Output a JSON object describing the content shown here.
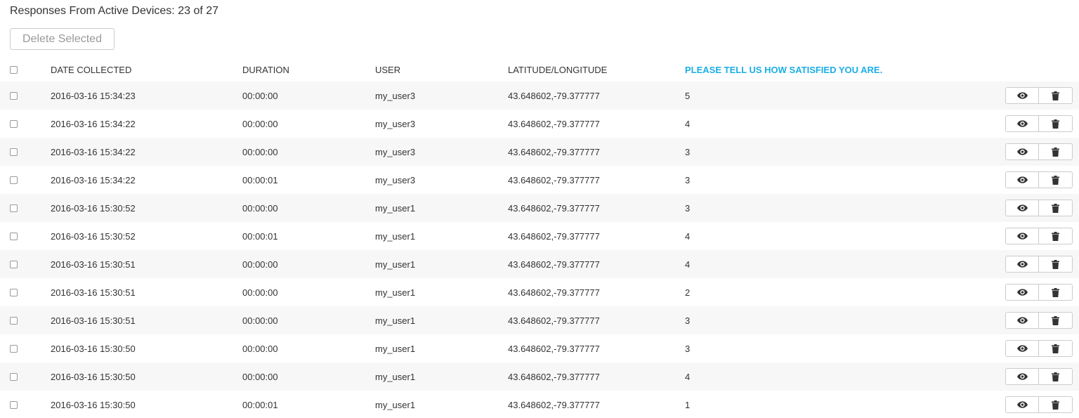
{
  "summary": "Responses From Active Devices: 23 of 27",
  "toolbar": {
    "delete_selected_label": "Delete Selected"
  },
  "table": {
    "headers": {
      "date": "DATE COLLECTED",
      "duration": "DURATION",
      "user": "USER",
      "latlong": "LATITUDE/LONGITUDE",
      "question": "PLEASE TELL US HOW SATISFIED YOU ARE."
    },
    "rows": [
      {
        "date": "2016-03-16 15:34:23",
        "duration": "00:00:00",
        "user": "my_user3",
        "latlong": "43.648602,-79.377777",
        "answer": "5"
      },
      {
        "date": "2016-03-16 15:34:22",
        "duration": "00:00:00",
        "user": "my_user3",
        "latlong": "43.648602,-79.377777",
        "answer": "4"
      },
      {
        "date": "2016-03-16 15:34:22",
        "duration": "00:00:00",
        "user": "my_user3",
        "latlong": "43.648602,-79.377777",
        "answer": "3"
      },
      {
        "date": "2016-03-16 15:34:22",
        "duration": "00:00:01",
        "user": "my_user3",
        "latlong": "43.648602,-79.377777",
        "answer": "3"
      },
      {
        "date": "2016-03-16 15:30:52",
        "duration": "00:00:00",
        "user": "my_user1",
        "latlong": "43.648602,-79.377777",
        "answer": "3"
      },
      {
        "date": "2016-03-16 15:30:52",
        "duration": "00:00:01",
        "user": "my_user1",
        "latlong": "43.648602,-79.377777",
        "answer": "4"
      },
      {
        "date": "2016-03-16 15:30:51",
        "duration": "00:00:00",
        "user": "my_user1",
        "latlong": "43.648602,-79.377777",
        "answer": "4"
      },
      {
        "date": "2016-03-16 15:30:51",
        "duration": "00:00:00",
        "user": "my_user1",
        "latlong": "43.648602,-79.377777",
        "answer": "2"
      },
      {
        "date": "2016-03-16 15:30:51",
        "duration": "00:00:00",
        "user": "my_user1",
        "latlong": "43.648602,-79.377777",
        "answer": "3"
      },
      {
        "date": "2016-03-16 15:30:50",
        "duration": "00:00:00",
        "user": "my_user1",
        "latlong": "43.648602,-79.377777",
        "answer": "3"
      },
      {
        "date": "2016-03-16 15:30:50",
        "duration": "00:00:00",
        "user": "my_user1",
        "latlong": "43.648602,-79.377777",
        "answer": "4"
      },
      {
        "date": "2016-03-16 15:30:50",
        "duration": "00:00:01",
        "user": "my_user1",
        "latlong": "43.648602,-79.377777",
        "answer": "1"
      }
    ]
  },
  "icons": {
    "view": "eye-icon",
    "delete": "trash-icon"
  },
  "colors": {
    "question_header": "#1aaee6",
    "row_stripe": "#f7f7f7",
    "icon": "#333333"
  }
}
